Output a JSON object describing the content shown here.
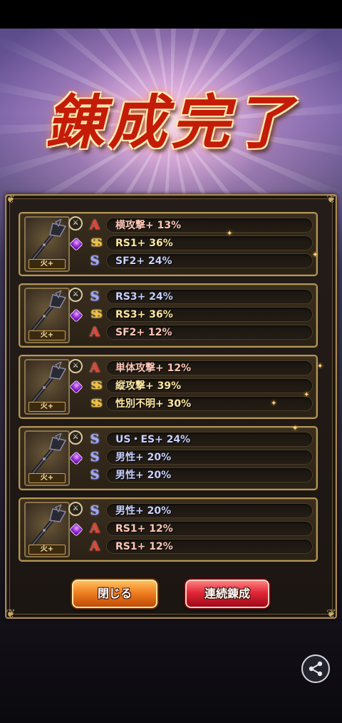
{
  "title": "錬成完了",
  "element_label": "火+",
  "colors": {
    "rank_A": "#e84030",
    "rank_S": "#a0a8ff",
    "rank_SS": "#f0c040",
    "panel_border": "#b49858"
  },
  "icons": {
    "rank_A": "A",
    "rank_S": "S",
    "rank_SS": "SS"
  },
  "results": [
    {
      "rows": [
        {
          "rank": "A",
          "text": "横攻撃+ 13%"
        },
        {
          "rank": "SS",
          "text": "RS1+ 36%"
        },
        {
          "rank": "S",
          "text": "SF2+ 24%"
        }
      ]
    },
    {
      "rows": [
        {
          "rank": "S",
          "text": "RS3+ 24%"
        },
        {
          "rank": "SS",
          "text": "RS3+ 36%"
        },
        {
          "rank": "A",
          "text": "SF2+ 12%"
        }
      ]
    },
    {
      "rows": [
        {
          "rank": "A",
          "text": "単体攻撃+ 12%"
        },
        {
          "rank": "SS",
          "text": "縦攻撃+ 39%"
        },
        {
          "rank": "SS",
          "text": "性別不明+ 30%"
        }
      ]
    },
    {
      "rows": [
        {
          "rank": "S",
          "text": "US・ES+ 24%"
        },
        {
          "rank": "S",
          "text": "男性+ 20%"
        },
        {
          "rank": "S",
          "text": "男性+ 20%"
        }
      ]
    },
    {
      "rows": [
        {
          "rank": "S",
          "text": "男性+ 20%"
        },
        {
          "rank": "A",
          "text": "RS1+ 12%"
        },
        {
          "rank": "A",
          "text": "RS1+ 12%"
        }
      ]
    }
  ],
  "buttons": {
    "close_label": "閉じる",
    "repeat_label": "連続錬成"
  },
  "share_icon": "share-icon"
}
